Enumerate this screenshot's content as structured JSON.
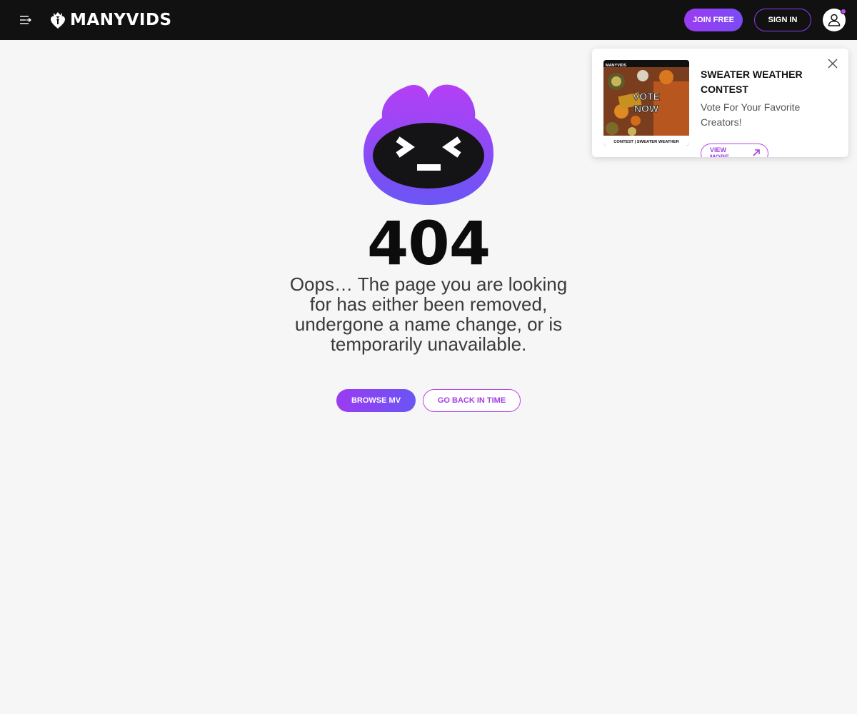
{
  "header": {
    "logo_text": "MANYVIDS",
    "join_label": "JOIN FREE",
    "signin_label": "SIGN IN"
  },
  "error": {
    "code": "404",
    "message": "Oops… The page you are looking for has either been removed, undergone a name change, or is temporarily unavailable.",
    "browse_label": "BROWSE MV",
    "back_label": "GO BACK IN TIME"
  },
  "promo": {
    "image_brand": "MANYVIDS",
    "image_headline_1": "VOTE",
    "image_headline_2": "NOW",
    "image_caption": "CONTEST | SWEATER WEATHER",
    "title": "SWEATER WEATHER CONTEST",
    "description": "Vote For Your Favorite Creators!",
    "cta_label": "VIEW MORE"
  },
  "colors": {
    "header_bg": "#111112",
    "accent": "#9b3bf2",
    "accent_secondary": "#6a55f5",
    "page_bg": "#f6f6f7"
  },
  "icons": {
    "menu": "menu-collapse-icon",
    "logo": "heart-crown-logo-icon",
    "avatar": "user-icon",
    "close": "close-icon",
    "cta": "arrow-up-right-icon"
  }
}
